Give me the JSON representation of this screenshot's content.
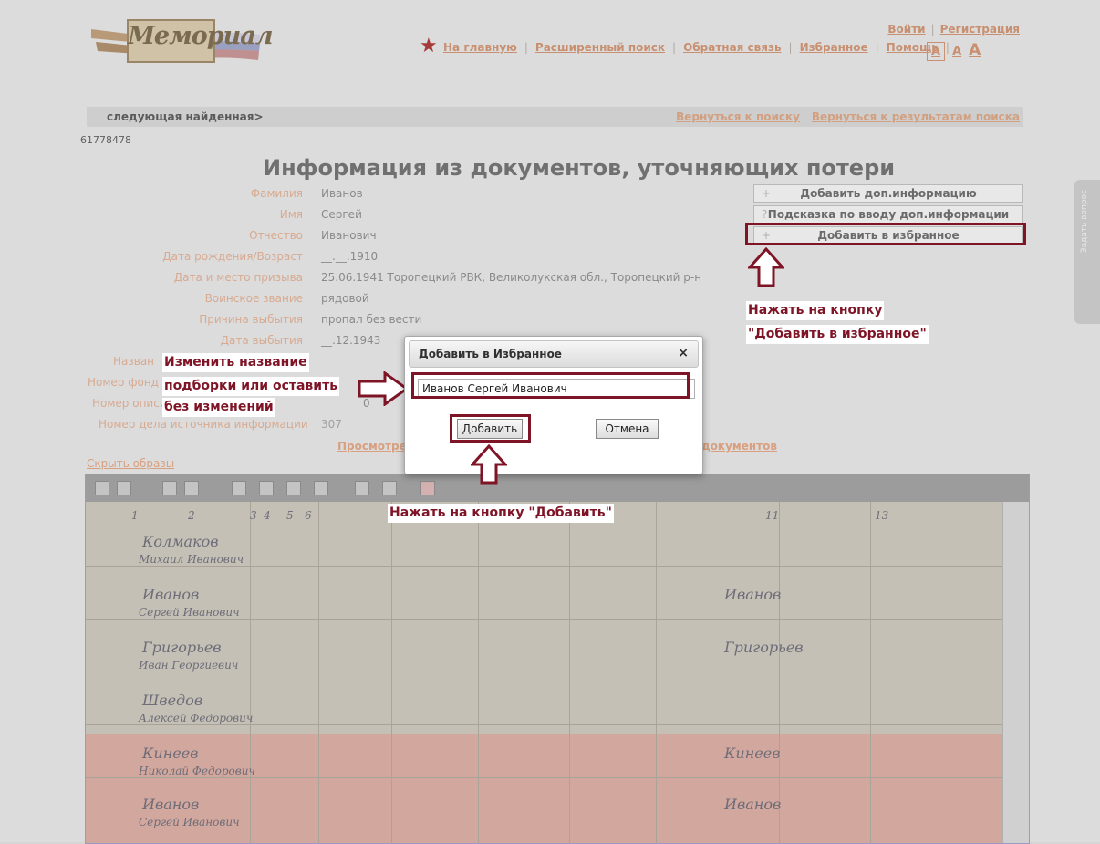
{
  "header": {
    "logo_text": "Мемориал",
    "auth": {
      "login": "Войти",
      "register": "Регистрация"
    },
    "nav": [
      "На главную",
      "Расширенный поиск",
      "Обратная связь",
      "Избранное",
      "Помощь"
    ],
    "font_sizes": [
      "A",
      "A",
      "A"
    ]
  },
  "breadcrumb": {
    "next": "следующая найденная>",
    "back_search": "Вернуться к поиску",
    "back_results": "Вернуться к результатам поиска"
  },
  "record": {
    "id": "61778478",
    "title": "Информация из документов, уточняющих потери",
    "fields": [
      {
        "label": "Фамилия",
        "value": "Иванов"
      },
      {
        "label": "Имя",
        "value": "Сергей"
      },
      {
        "label": "Отчество",
        "value": "Иванович"
      },
      {
        "label": "Дата рождения/Возраст",
        "value": "__.__.1910"
      },
      {
        "label": "Дата и место призыва",
        "value": "25.06.1941 Торопецкий РВК, Великолукская обл., Торопецкий р-н"
      },
      {
        "label": "Воинское звание",
        "value": "рядовой"
      },
      {
        "label": "Причина выбытия",
        "value": "пропал без вести"
      },
      {
        "label": "Дата выбытия",
        "value": "__.12.1943"
      }
    ],
    "partial_labels": [
      "Назван",
      "Номер фонд",
      "Номер описи",
      "Номер дела источника информации"
    ],
    "partial_values": [
      "0",
      "307"
    ]
  },
  "actions": {
    "add_info": {
      "icon": "+",
      "label": "Добавить доп.информацию"
    },
    "hint": {
      "icon": "?",
      "label": "Подсказка по вводу доп.информации"
    },
    "add_fav": {
      "icon": "+",
      "label": "Добавить в избранное"
    }
  },
  "doc_links": {
    "view": "Просмотре",
    "docs": "документов"
  },
  "hide_images": "Скрыть образы",
  "side_tab": "Задать вопрос",
  "dialog": {
    "title": "Добавить в Избранное",
    "close": "×",
    "input_value": "Иванов Сергей Иванович",
    "add": "Добавить",
    "cancel": "Отмена"
  },
  "callouts": {
    "fav_line1": "Нажать на кнопку",
    "fav_line2": "\"Добавить в избранное\"",
    "rename_line1": "Изменить название",
    "rename_line2": "подборки или оставить",
    "rename_line3": "без изменений",
    "add": "Нажать на кнопку \"Добавить\""
  },
  "scan": {
    "names": [
      "Колмаков",
      "Иванов",
      "Григорьев",
      "Шведов",
      "Кинеев",
      "Иванов"
    ],
    "firstnames": [
      "Михаил Иванович",
      "Сергей Иванович",
      "Иван Георгиевич",
      "Алексей Федорович",
      "Николай Федорович",
      "Сергей Иванович"
    ],
    "col_numbers": [
      "1",
      "2",
      "3",
      "4",
      "5",
      "6",
      "11",
      "13"
    ]
  },
  "colors": {
    "accent": "#7e1426",
    "link": "#c89070",
    "overlay": "#dcdcdc"
  }
}
